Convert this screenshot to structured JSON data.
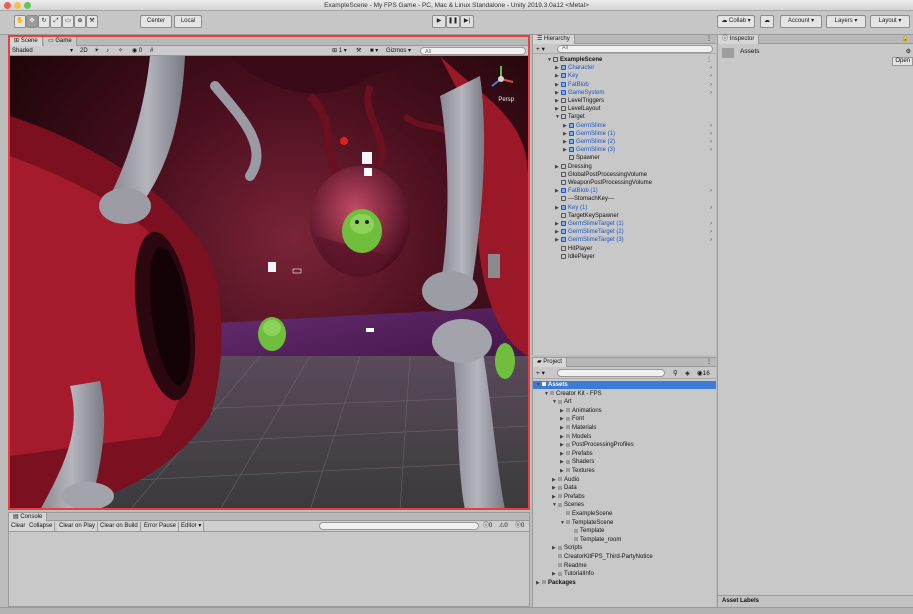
{
  "window": {
    "title": "ExampleScene - My FPS Game - PC, Mac & Linux Standalone - Unity 2019.3.0a12 <Metal>"
  },
  "toolbar": {
    "center_label": "Center",
    "local_label": "Local",
    "collab_label": "Collab",
    "account_label": "Account",
    "layers_label": "Layers",
    "layout_label": "Layout"
  },
  "scene": {
    "tabs": [
      "Scene",
      "Game"
    ],
    "shading_mode": "Shaded",
    "mode_2d": "2D",
    "scale": "1",
    "gizmos_label": "Gizmos",
    "search_placeholder": "All",
    "persp_label": "Persp"
  },
  "console": {
    "tab_label": "Console",
    "buttons": [
      "Clear",
      "Collapse",
      "Clear on Play",
      "Clear on Build",
      "Error Pause",
      "Editor"
    ],
    "counts": [
      "0",
      "0",
      "0"
    ]
  },
  "hierarchy": {
    "tab_label": "Hierarchy",
    "search_placeholder": "All",
    "items": [
      {
        "label": "ExampleScene",
        "depth": 0,
        "type": "scene",
        "bold": true
      },
      {
        "label": "Character",
        "depth": 1,
        "type": "prefab"
      },
      {
        "label": "Key",
        "depth": 1,
        "type": "prefab"
      },
      {
        "label": "FatBlob",
        "depth": 1,
        "type": "prefab"
      },
      {
        "label": "GameSystem",
        "depth": 1,
        "type": "prefab"
      },
      {
        "label": "LevelTriggers",
        "depth": 1,
        "type": "object"
      },
      {
        "label": "LevelLayout",
        "depth": 1,
        "type": "object"
      },
      {
        "label": "Target",
        "depth": 1,
        "type": "object"
      },
      {
        "label": "GermSlime",
        "depth": 2,
        "type": "prefab"
      },
      {
        "label": "GermSlime (1)",
        "depth": 2,
        "type": "prefab"
      },
      {
        "label": "GermSlime (2)",
        "depth": 2,
        "type": "prefab"
      },
      {
        "label": "GermSlime (3)",
        "depth": 2,
        "type": "prefab"
      },
      {
        "label": "Spawner",
        "depth": 2,
        "type": "object"
      },
      {
        "label": "Dressing",
        "depth": 1,
        "type": "object"
      },
      {
        "label": "GlobalPostProcessingVolume",
        "depth": 1,
        "type": "object"
      },
      {
        "label": "WeaponPostProcessingVolume",
        "depth": 1,
        "type": "object"
      },
      {
        "label": "FatBlob (1)",
        "depth": 1,
        "type": "prefab"
      },
      {
        "label": "---StomachKey---",
        "depth": 1,
        "type": "object"
      },
      {
        "label": "Key (1)",
        "depth": 1,
        "type": "prefab"
      },
      {
        "label": "TargetKeySpawner",
        "depth": 1,
        "type": "object"
      },
      {
        "label": "GermSlimeTarget (1)",
        "depth": 1,
        "type": "prefab"
      },
      {
        "label": "GermSlimeTarget (2)",
        "depth": 1,
        "type": "prefab"
      },
      {
        "label": "GermSlimeTarget (3)",
        "depth": 1,
        "type": "prefab"
      },
      {
        "label": "HitPlayer",
        "depth": 1,
        "type": "object"
      },
      {
        "label": "IdlePlayer",
        "depth": 1,
        "type": "object"
      }
    ]
  },
  "project": {
    "tab_label": "Project",
    "count": "16",
    "items": [
      {
        "label": "Assets",
        "depth": 0,
        "selected": true
      },
      {
        "label": "Creator Kit - FPS",
        "depth": 1
      },
      {
        "label": "Art",
        "depth": 2
      },
      {
        "label": "Animations",
        "depth": 3
      },
      {
        "label": "Font",
        "depth": 3
      },
      {
        "label": "Materials",
        "depth": 3
      },
      {
        "label": "Models",
        "depth": 3
      },
      {
        "label": "PostProcessingProfiles",
        "depth": 3
      },
      {
        "label": "Prefabs",
        "depth": 3
      },
      {
        "label": "Shaders",
        "depth": 3
      },
      {
        "label": "Textures",
        "depth": 3
      },
      {
        "label": "Audio",
        "depth": 2
      },
      {
        "label": "Data",
        "depth": 2
      },
      {
        "label": "Prefabs",
        "depth": 2
      },
      {
        "label": "Scenes",
        "depth": 2
      },
      {
        "label": "ExampleScene",
        "depth": 3
      },
      {
        "label": "TemplateScene",
        "depth": 3
      },
      {
        "label": "Template",
        "depth": 4
      },
      {
        "label": "Template_room",
        "depth": 4
      },
      {
        "label": "Scripts",
        "depth": 2
      },
      {
        "label": "CreatorKitFPS_Third-PartyNotice",
        "depth": 2
      },
      {
        "label": "Readme",
        "depth": 2
      },
      {
        "label": "TutorialInfo",
        "depth": 2
      },
      {
        "label": "Packages",
        "depth": 0,
        "bold": true
      }
    ]
  },
  "inspector": {
    "tab_label": "Inspector",
    "asset_title": "Assets",
    "open_label": "Open",
    "asset_labels": "Asset Labels"
  },
  "colors": {
    "selection": "#3d7bd9",
    "scene_highlight": "#e84040",
    "prefab_blue": "#1a56c9"
  }
}
